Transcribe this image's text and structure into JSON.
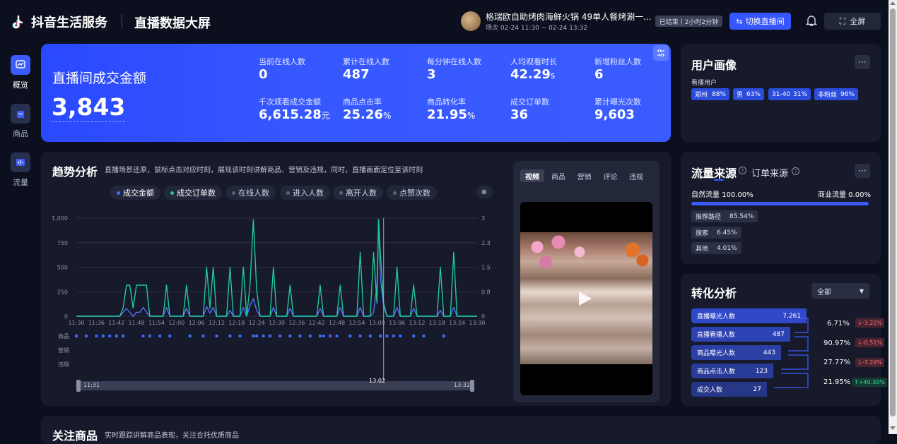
{
  "header": {
    "brand": "抖音生活服务",
    "divider": "|",
    "title": "直播数据大屏",
    "live_title": "格瑞欧自助烤肉海鲜火锅 49单人餐烤涮一...",
    "session": "场次 02-24 11:30 ~ 02-24 13:32",
    "status": "已结束丨2小时2分钟",
    "switch_label": "切换直播间",
    "fullscreen_label": "全屏"
  },
  "sidebar": {
    "items": [
      {
        "label": "概览",
        "active": true
      },
      {
        "label": "商品",
        "active": false
      },
      {
        "label": "流量",
        "active": false
      }
    ]
  },
  "summary": {
    "main_label": "直播间成交金额",
    "main_value": "3,843",
    "stats": [
      {
        "label": "当前在线人数",
        "value": "0",
        "unit": ""
      },
      {
        "label": "累计在线人数",
        "value": "487",
        "unit": ""
      },
      {
        "label": "每分钟在线人数",
        "value": "3",
        "unit": ""
      },
      {
        "label": "人均观看时长",
        "value": "42.29",
        "unit": "s"
      },
      {
        "label": "新增粉丝人数",
        "value": "6",
        "unit": ""
      },
      {
        "label": "千次观看成交金额",
        "value": "6,615.28",
        "unit": "元"
      },
      {
        "label": "商品点击率",
        "value": "25.26",
        "unit": "%"
      },
      {
        "label": "商品转化率",
        "value": "21.95",
        "unit": "%"
      },
      {
        "label": "成交订单数",
        "value": "36",
        "unit": ""
      },
      {
        "label": "累计曝光次数",
        "value": "9,603",
        "unit": ""
      }
    ]
  },
  "trend": {
    "title": "趋势分析",
    "desc": "直播场景还原，鼠标点击对应时刻，展现该时刻讲解商品、营销及违规，同时，直播画面定位至该时刻",
    "legend": [
      {
        "label": "成交金额",
        "color": "#4f6bff",
        "active": true
      },
      {
        "label": "成交订单数",
        "color": "#1fc99a",
        "active": true
      },
      {
        "label": "在线人数",
        "color": "#5c6280",
        "active": false
      },
      {
        "label": "进入人数",
        "color": "#5c6280",
        "active": false
      },
      {
        "label": "离开人数",
        "color": "#5c6280",
        "active": false
      },
      {
        "label": "点赞次数",
        "color": "#5c6280",
        "active": false
      }
    ],
    "row_labels": [
      "商品",
      "营销",
      "违规"
    ],
    "slider_start": "11:31",
    "slider_mid": "13:02",
    "slider_end": "13:32"
  },
  "chart_data": {
    "type": "line",
    "x_ticks": [
      "11:30",
      "11:36",
      "11:42",
      "11:48",
      "11:54",
      "12:00",
      "12:06",
      "12:12",
      "12:18",
      "12:24",
      "12:30",
      "12:36",
      "12:42",
      "12:48",
      "12:54",
      "13:00",
      "13:06",
      "13:12",
      "13:18",
      "13:24",
      "13:30"
    ],
    "y_left_ticks": [
      "1,000",
      "750",
      "500",
      "250",
      "0"
    ],
    "y_right_ticks": [
      "3",
      "2.3",
      "1.5",
      "0.8",
      "0"
    ],
    "ylim_left": [
      0,
      1000
    ],
    "ylim_right": [
      0,
      3
    ],
    "x_range": [
      0,
      120
    ],
    "cursor_x": 92,
    "series": [
      {
        "name": "成交金额",
        "axis": "left",
        "color": "#5b6dff",
        "points": [
          [
            0,
            0
          ],
          [
            13,
            0
          ],
          [
            14,
            40
          ],
          [
            15,
            80
          ],
          [
            16,
            40
          ],
          [
            17,
            0
          ],
          [
            18,
            40
          ],
          [
            19,
            40
          ],
          [
            20,
            90
          ],
          [
            21,
            40
          ],
          [
            22,
            0
          ],
          [
            26,
            0
          ],
          [
            27,
            90
          ],
          [
            28,
            0
          ],
          [
            32,
            0
          ],
          [
            33,
            80
          ],
          [
            34,
            0
          ],
          [
            38,
            0
          ],
          [
            39,
            100
          ],
          [
            40,
            30
          ],
          [
            41,
            90
          ],
          [
            42,
            0
          ],
          [
            45,
            0
          ],
          [
            46,
            60
          ],
          [
            47,
            0
          ],
          [
            49,
            0
          ],
          [
            50,
            90
          ],
          [
            51,
            0
          ],
          [
            52,
            110
          ],
          [
            53,
            180
          ],
          [
            54,
            60
          ],
          [
            55,
            0
          ],
          [
            58,
            0
          ],
          [
            59,
            90
          ],
          [
            60,
            0
          ],
          [
            63,
            0
          ],
          [
            64,
            80
          ],
          [
            65,
            0
          ],
          [
            72,
            0
          ],
          [
            73,
            80
          ],
          [
            74,
            0
          ],
          [
            78,
            0
          ],
          [
            79,
            90
          ],
          [
            80,
            0
          ],
          [
            84,
            0
          ],
          [
            85,
            90
          ],
          [
            86,
            0
          ],
          [
            88,
            0
          ],
          [
            89,
            40
          ],
          [
            90,
            320
          ],
          [
            90.5,
            990
          ],
          [
            91,
            400
          ],
          [
            92,
            100
          ],
          [
            93,
            0
          ],
          [
            95,
            0
          ],
          [
            96,
            90
          ],
          [
            97,
            0
          ],
          [
            100,
            0
          ],
          [
            101,
            80
          ],
          [
            102,
            0
          ],
          [
            108,
            0
          ],
          [
            109,
            60
          ],
          [
            110,
            0
          ],
          [
            112,
            0
          ],
          [
            113,
            90
          ],
          [
            114,
            0
          ],
          [
            120,
            0
          ]
        ]
      },
      {
        "name": "成交订单数",
        "axis": "right",
        "color": "#1fc99a",
        "points": [
          [
            0,
            0
          ],
          [
            13,
            0
          ],
          [
            14,
            0.25
          ],
          [
            15,
            0.95
          ],
          [
            16,
            0.95
          ],
          [
            17,
            0.25
          ],
          [
            18,
            0.95
          ],
          [
            19,
            0.95
          ],
          [
            20,
            0.95
          ],
          [
            21,
            0.95
          ],
          [
            22,
            0
          ],
          [
            26,
            0
          ],
          [
            27,
            0.95
          ],
          [
            28,
            0
          ],
          [
            32,
            0
          ],
          [
            33,
            0.95
          ],
          [
            34,
            0
          ],
          [
            38,
            0
          ],
          [
            39,
            1.5
          ],
          [
            40,
            0.25
          ],
          [
            41,
            1.5
          ],
          [
            42,
            0
          ],
          [
            45,
            0
          ],
          [
            46,
            1.5
          ],
          [
            47,
            0
          ],
          [
            49,
            0
          ],
          [
            50,
            1.5
          ],
          [
            51,
            0
          ],
          [
            52,
            0.95
          ],
          [
            53,
            2.95
          ],
          [
            54,
            0.8
          ],
          [
            55,
            0
          ],
          [
            58,
            0
          ],
          [
            59,
            1.5
          ],
          [
            60,
            0
          ],
          [
            63,
            0
          ],
          [
            64,
            0.95
          ],
          [
            65,
            0
          ],
          [
            72,
            0
          ],
          [
            73,
            0.95
          ],
          [
            74,
            0
          ],
          [
            78,
            0
          ],
          [
            79,
            0.95
          ],
          [
            80,
            0
          ],
          [
            84,
            0
          ],
          [
            85,
            1.95
          ],
          [
            86,
            0
          ],
          [
            88,
            0
          ],
          [
            89,
            1.95
          ],
          [
            90,
            0.4
          ],
          [
            90.5,
            2.95
          ],
          [
            91,
            1.95
          ],
          [
            92,
            0.4
          ],
          [
            93,
            0
          ],
          [
            95,
            0
          ],
          [
            96,
            1.5
          ],
          [
            97,
            0
          ],
          [
            100,
            0
          ],
          [
            101,
            0.95
          ],
          [
            102,
            0
          ],
          [
            108,
            0
          ],
          [
            109,
            1.5
          ],
          [
            110,
            0
          ],
          [
            112,
            0
          ],
          [
            113,
            1.95
          ],
          [
            114,
            0
          ],
          [
            120,
            0
          ]
        ]
      }
    ],
    "product_events": [
      0,
      3,
      6,
      8,
      10,
      12,
      14,
      20,
      22,
      25,
      28,
      34,
      38,
      42,
      46,
      49,
      53,
      54,
      56,
      58,
      61,
      64,
      67,
      70,
      73,
      74,
      76,
      78,
      82,
      85,
      88,
      91,
      93,
      95,
      97,
      101,
      104,
      110
    ]
  },
  "video": {
    "tabs": [
      {
        "label": "视频",
        "active": true
      },
      {
        "label": "商品",
        "active": false
      },
      {
        "label": "营销",
        "active": false
      },
      {
        "label": "评论",
        "active": false
      },
      {
        "label": "违规",
        "active": false
      }
    ]
  },
  "portrait": {
    "title": "用户画像",
    "more": "···",
    "sub": "看播用户",
    "tags": [
      {
        "label": "郑州",
        "value": "88%"
      },
      {
        "label": "男",
        "value": "63%"
      },
      {
        "label": "31-40",
        "value": "31%"
      },
      {
        "label": "非粉丝",
        "value": "96%"
      }
    ]
  },
  "traffic": {
    "tab_active": "流量来源",
    "tab_other": "订单来源",
    "more": "···",
    "natural_label": "自然流量 100.00%",
    "commercial_label": "商业流量 0.00%",
    "natural_fraction": 1.0,
    "items": [
      {
        "label": "推荐路径",
        "value": "85.54%"
      },
      {
        "label": "搜索",
        "value": "6.45%"
      },
      {
        "label": "其他",
        "value": "4.01%"
      }
    ]
  },
  "conversion": {
    "title": "转化分析",
    "filter": "全部",
    "funnel": [
      {
        "label": "直播曝光人数",
        "value": "7,261"
      },
      {
        "label": "直播看播人数",
        "value": "487"
      },
      {
        "label": "商品曝光人数",
        "value": "443"
      },
      {
        "label": "商品点击人数",
        "value": "123"
      },
      {
        "label": "成交人数",
        "value": "27"
      }
    ],
    "rates": [
      {
        "rate": "6.71%",
        "delta": "↓-3.21%",
        "dir": "down"
      },
      {
        "rate": "90.97%",
        "delta": "↓-0.51%",
        "dir": "down"
      },
      {
        "rate": "27.77%",
        "delta": "↓-3.29%",
        "dir": "down"
      },
      {
        "rate": "21.95%",
        "delta": "↑+40.30%",
        "dir": "up"
      }
    ]
  },
  "bottom": {
    "title": "关注商品",
    "desc": "实时跟踪讲解商品表现，关注合托优质商品"
  },
  "colors": {
    "accent": "#3657ff",
    "green": "#1fc99a",
    "down_bg": "#4a2330",
    "down_fg": "#ff6b7a",
    "up_bg": "#153a32",
    "up_fg": "#3ddc9a"
  }
}
